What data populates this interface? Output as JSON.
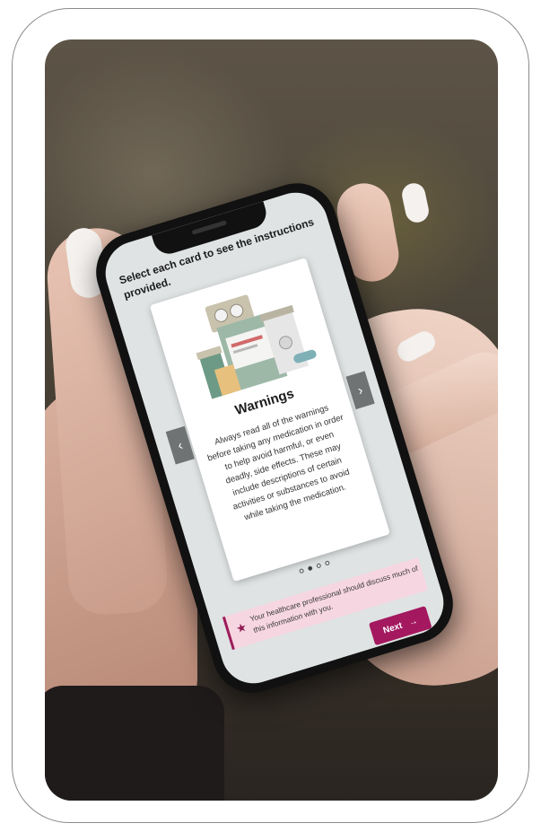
{
  "screen": {
    "instructions": "Select each card to see the instructions provided."
  },
  "card": {
    "title": "Warnings",
    "body": "Always read all of the warnings before taking any medication in order to help avoid harmful, or even deadly, side effects. These may include descriptions of certain activities or substances to avoid while taking the medication.",
    "illustration_icon": "medicine-bottles-illustration"
  },
  "carousel": {
    "prev_icon": "chevron-left-icon",
    "next_icon": "chevron-right-icon",
    "prev_glyph": "‹",
    "next_glyph": "›",
    "dot_count": 4,
    "active_index": 1
  },
  "note": {
    "icon": "star-icon",
    "text": "Your healthcare professional should discuss much of this information with you."
  },
  "next_button": {
    "label": "Next",
    "arrow": "→"
  },
  "colors": {
    "accent": "#a3185f",
    "note_bg": "#f6d6e0",
    "screen_bg": "#dfe3e3"
  }
}
